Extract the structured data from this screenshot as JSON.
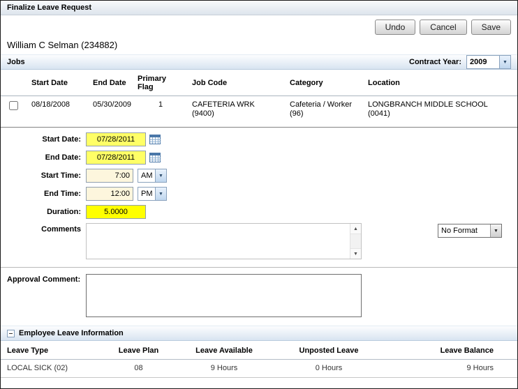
{
  "page": {
    "title": "Finalize Leave Request"
  },
  "toolbar": {
    "undo_label": "Undo",
    "cancel_label": "Cancel",
    "save_label": "Save"
  },
  "employee": {
    "name": "William C Selman (234882)"
  },
  "icons": {
    "dropdown": "▼",
    "scroll_up": "▲",
    "scroll_down": "▼"
  },
  "colors": {
    "required_field_yellow": "#ffff00",
    "date_field_yellow": "#ffff66",
    "time_field_cream": "#fdf6dd",
    "section_bar_blue": "#d8e4f1"
  },
  "jobs": {
    "section_title": "Jobs",
    "contract_year_label": "Contract Year:",
    "contract_year_value": "2009",
    "columns": [
      "Start Date",
      "End Date",
      "Primary Flag",
      "Job Code",
      "Category",
      "Location"
    ],
    "row": {
      "start_date": "08/18/2008",
      "end_date": "05/30/2009",
      "primary_flag": "1",
      "job_code_line1": "CAFETERIA WRK",
      "job_code_line2": "(9400)",
      "category_line1": "Cafeteria / Worker",
      "category_line2": "(96)",
      "location_line1": "LONGBRANCH MIDDLE SCHOOL",
      "location_line2": "(0041)"
    }
  },
  "form": {
    "start_date_label": "Start Date:",
    "start_date_value": "07/28/2011",
    "end_date_label": "End Date:",
    "end_date_value": "07/28/2011",
    "start_time_label": "Start Time:",
    "start_time_value": "7:00",
    "start_time_ampm": "AM",
    "end_time_label": "End Time:",
    "end_time_value": "12:00",
    "end_time_ampm": "PM",
    "duration_label": "Duration:",
    "duration_value": "5.0000",
    "comments_label": "Comments",
    "comments_value": "",
    "comments_format": "No Format",
    "approval_label": "Approval Comment:",
    "approval_value": ""
  },
  "leave_info": {
    "section_title": "Employee Leave Information",
    "columns": [
      "Leave Type",
      "Leave Plan",
      "Leave Available",
      "Unposted Leave",
      "Leave Balance"
    ],
    "row": {
      "leave_type": "LOCAL SICK (02)",
      "leave_plan": "08",
      "leave_available": "9 Hours",
      "unposted_leave": "0 Hours",
      "leave_balance": "9 Hours"
    }
  }
}
